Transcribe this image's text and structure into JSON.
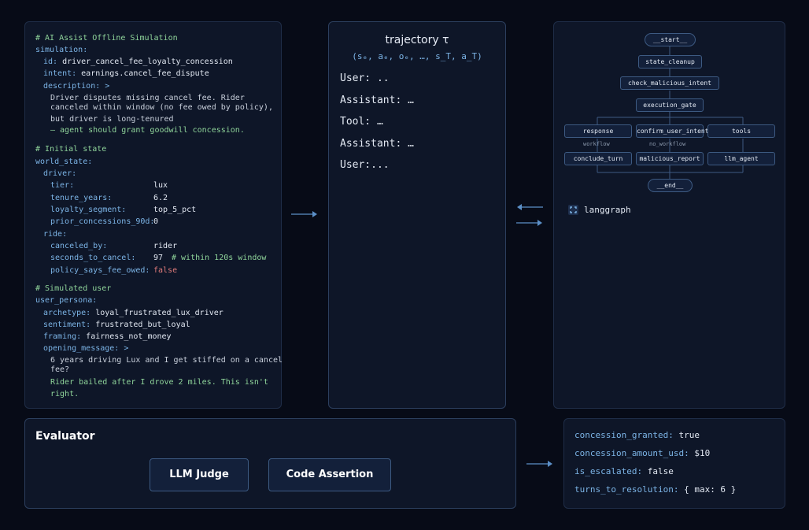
{
  "simulation_yaml": [
    {
      "t": "# AI Assist Offline Simulation",
      "k": "comment",
      "indent": 0
    },
    {
      "t": "simulation:",
      "k": "key",
      "indent": 0
    },
    {
      "t": "id:",
      "v": "driver_cancel_fee_loyalty_concession",
      "k": "kv",
      "indent": 1
    },
    {
      "t": "intent:",
      "v": "earnings.cancel_fee_dispute",
      "k": "kv",
      "indent": 1
    },
    {
      "t": "description: >",
      "k": "key",
      "indent": 1
    },
    {
      "t": "Driver disputes missing cancel fee. Rider",
      "k": "str",
      "indent": 2
    },
    {
      "t": "canceled within window (no fee owed by policy),",
      "k": "str",
      "indent": 2
    },
    {
      "t": "but driver is long-tenured",
      "k": "str",
      "indent": 2
    },
    {
      "t": "– agent should grant goodwill concession.",
      "k": "comment",
      "indent": 2
    },
    {
      "t": "# Initial state",
      "k": "comment",
      "indent": 0
    },
    {
      "t": "world_state:",
      "k": "key",
      "indent": 0
    },
    {
      "t": "driver:",
      "k": "key",
      "indent": 1
    },
    {
      "t": "tier:",
      "v": "lux",
      "k": "kvc",
      "indent": 2
    },
    {
      "t": "tenure_years:",
      "v": "6.2",
      "k": "kvc",
      "indent": 2
    },
    {
      "t": "loyalty_segment:",
      "v": "top_5_pct",
      "k": "kvc",
      "indent": 2
    },
    {
      "t": "prior_concessions_90d:",
      "v": "0",
      "k": "kvc",
      "indent": 2
    },
    {
      "t": "ride:",
      "k": "key",
      "indent": 1
    },
    {
      "t": "canceled_by:",
      "v": "rider",
      "k": "kvc",
      "indent": 2
    },
    {
      "t": "seconds_to_cancel:",
      "v": "97",
      "c": "# within 120s window",
      "k": "kvc",
      "indent": 2
    },
    {
      "t": "policy_says_fee_owed:",
      "v": "false",
      "k": "kvr",
      "indent": 2
    },
    {
      "t": "# Simulated user",
      "k": "comment",
      "indent": 0
    },
    {
      "t": "user_persona:",
      "k": "key",
      "indent": 0
    },
    {
      "t": "archetype:",
      "v": "loyal_frustrated_lux_driver",
      "k": "kv",
      "indent": 1
    },
    {
      "t": "sentiment:",
      "v": "frustrated_but_loyal",
      "k": "kv",
      "indent": 1
    },
    {
      "t": "framing:",
      "v": "fairness_not_money",
      "k": "kv",
      "indent": 1
    },
    {
      "t": "opening_message: >",
      "k": "key",
      "indent": 1
    },
    {
      "t": "6 years driving Lux and I get stiffed on a cancel",
      "k": "str",
      "indent": 2
    },
    {
      "t": "fee?",
      "k": "str",
      "indent": 2
    },
    {
      "t": "Rider bailed after I drove 2 miles. This isn't",
      "k": "comment",
      "indent": 2
    },
    {
      "t": "right.",
      "k": "comment",
      "indent": 2
    }
  ],
  "trajectory": {
    "title": "trajectory τ",
    "subtitle": "(sₑ, aₑ, oₑ, …, s_T, a_T)",
    "lines": [
      "User: ..",
      "Assistant: …",
      "Tool: …",
      "Assistant: …",
      "User:..."
    ]
  },
  "graph": {
    "start": "__start__",
    "state_cleanup": "state_cleanup",
    "check_malicious_intent": "check_malicious_intent",
    "execution_gate": "execution_gate",
    "response": "response",
    "confirm_user_intent": "confirm_user_intent",
    "tools": "tools",
    "workflow_label": "workflow",
    "no_workflow_label": "no_workflow",
    "conclude_turn": "conclude_turn",
    "malicious_report": "malicious_report",
    "llm_agent": "llm_agent",
    "end": "__end__",
    "brand": "langgraph"
  },
  "evaluator": {
    "title": "Evaluator",
    "llm_judge": "LLM Judge",
    "code_assertion": "Code Assertion"
  },
  "results": [
    {
      "key": "concession_granted:",
      "value": "true"
    },
    {
      "key": "concession_amount_usd:",
      "value": "$10"
    },
    {
      "key": "is_escalated:",
      "value": "false"
    },
    {
      "key": "turns_to_resolution:",
      "value": "{ max: 6 }"
    }
  ],
  "colors": {
    "accent": "#7cb4e6",
    "comment": "#8fd49a",
    "false": "#e07a7a",
    "arrow": "#5b8fc7"
  }
}
